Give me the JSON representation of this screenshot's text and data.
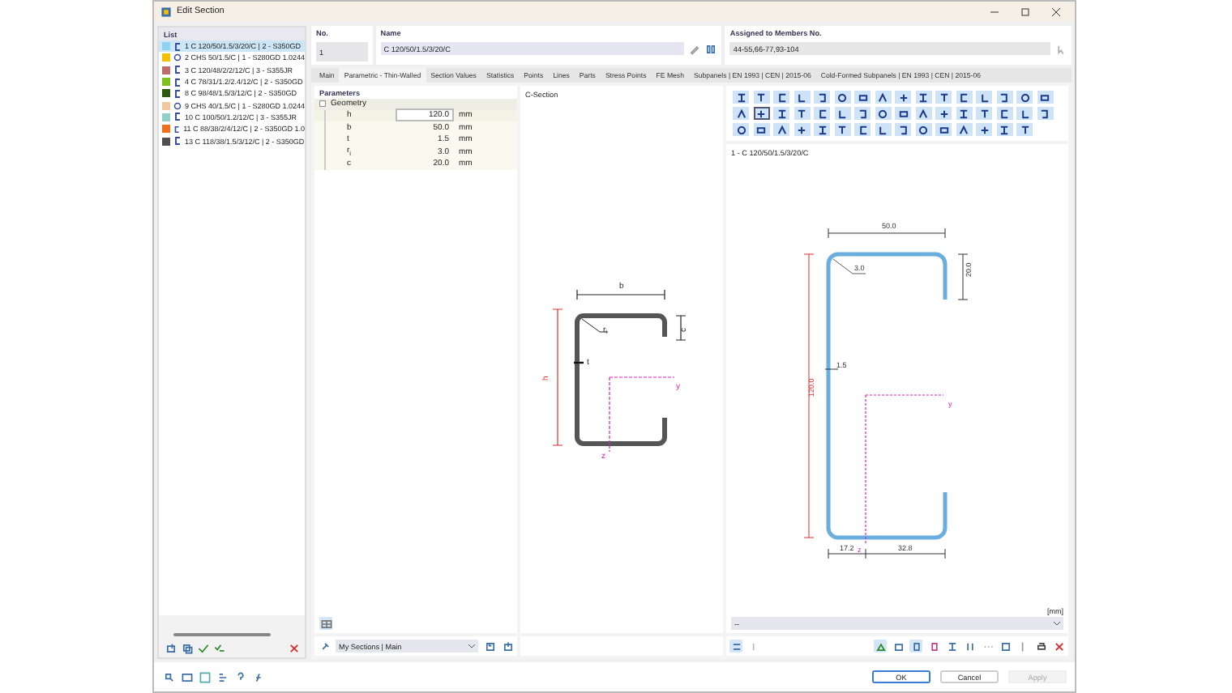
{
  "window": {
    "title": "Edit Section"
  },
  "list": {
    "title": "List",
    "items": [
      {
        "number": "1",
        "label": "C 120/50/1.5/3/20/C | 2 - S350GD",
        "kind": "c-shape",
        "color": "#8fd3f0",
        "selected": true
      },
      {
        "number": "2",
        "label": "CHS 50/1.5/C | 1 - S280GD 1.0244",
        "kind": "tube",
        "color": "#f5c000",
        "selected": false
      },
      {
        "number": "3",
        "label": "C 120/48/2/2/12/C | 3 - S355JR",
        "kind": "c-shape",
        "color": "#c06a6a",
        "selected": false
      },
      {
        "number": "4",
        "label": "C 78/31/1.2/2.4/12/C | 2 - S350GD",
        "kind": "c-shape",
        "color": "#7fc020",
        "selected": false
      },
      {
        "number": "8",
        "label": "C 98/48/1.5/3/12/C | 2 - S350GD",
        "kind": "c-shape",
        "color": "#2c5a10",
        "selected": false
      },
      {
        "number": "9",
        "label": "CHS 40/1.5/C | 1 - S280GD 1.0244",
        "kind": "tube",
        "color": "#f0c8a0",
        "selected": false
      },
      {
        "number": "10",
        "label": "C 100/50/1.2/12/C | 3 - S355JR",
        "kind": "c-shape",
        "color": "#90d0c8",
        "selected": false
      },
      {
        "number": "11",
        "label": "C 88/38/2/4/12/C | 2 - S350GD 1.0",
        "kind": "c-shape",
        "color": "#f07020",
        "selected": false
      },
      {
        "number": "13",
        "label": "C 118/38/1.5/3/12/C | 2 - S350GD",
        "kind": "c-shape",
        "color": "#505050",
        "selected": false
      }
    ]
  },
  "number_field": {
    "label": "No.",
    "value": "1"
  },
  "name_field": {
    "label": "Name",
    "value": "C 120/50/1.5/3/20/C"
  },
  "members_field": {
    "label": "Assigned to Members No.",
    "value": "44-55,66-77,93-104"
  },
  "tabs": [
    {
      "label": "Main",
      "selected": false
    },
    {
      "label": "Parametric - Thin-Walled",
      "selected": true
    },
    {
      "label": "Section Values",
      "selected": false
    },
    {
      "label": "Statistics",
      "selected": false
    },
    {
      "label": "Points",
      "selected": false
    },
    {
      "label": "Lines",
      "selected": false
    },
    {
      "label": "Parts",
      "selected": false
    },
    {
      "label": "Stress Points",
      "selected": false
    },
    {
      "label": "FE Mesh",
      "selected": false
    },
    {
      "label": "Subpanels | EN 1993 | CEN | 2015-06",
      "selected": false
    },
    {
      "label": "Cold-Formed Subpanels | EN 1993 | CEN | 2015-06",
      "selected": false
    }
  ],
  "parameters": {
    "title": "Parameters",
    "group": "Geometry",
    "rows": [
      {
        "symbol": "h",
        "value": "120.0",
        "unit": "mm",
        "selected": true
      },
      {
        "symbol": "b",
        "value": "50.0",
        "unit": "mm",
        "selected": false
      },
      {
        "symbol": "t",
        "value": "1.5",
        "unit": "mm",
        "selected": false
      },
      {
        "symbol": "r$_{i}$",
        "value": "3.0",
        "unit": "mm",
        "selected": false
      },
      {
        "symbol": "c",
        "value": "20.0",
        "unit": "mm",
        "selected": false
      }
    ]
  },
  "library": {
    "value": "My Sections | Main"
  },
  "section_sketch": {
    "title": "C-Section",
    "labels": [
      {
        "kind": "width",
        "text": "b"
      },
      {
        "kind": "lip",
        "text": "c"
      },
      {
        "kind": "height",
        "text": "h"
      },
      {
        "kind": "thickness",
        "text": "t"
      },
      {
        "kind": "radius",
        "text": "r$_{i}$"
      },
      {
        "kind": "y-axis",
        "text": "y"
      },
      {
        "kind": "z-axis",
        "text": "z"
      }
    ]
  },
  "preview": {
    "caption": "1 - C 120/50/1.5/3/20/C",
    "unit_note": "[mm]",
    "dropdown": "--",
    "labels": [
      {
        "kind": "width",
        "text": "50.0"
      },
      {
        "kind": "lip",
        "text": "20.0"
      },
      {
        "kind": "height",
        "text": "120.0"
      },
      {
        "kind": "thickness",
        "text": "1.5"
      },
      {
        "kind": "radius",
        "text": "3.0"
      },
      {
        "kind": "left-offset",
        "text": "17.2"
      },
      {
        "kind": "right-offset",
        "text": "32.8"
      },
      {
        "kind": "y-axis",
        "text": "y"
      },
      {
        "kind": "z-axis",
        "text": "z"
      }
    ]
  },
  "buttons": [
    {
      "label": "OK",
      "disabled": false,
      "focused": true
    },
    {
      "label": "Cancel",
      "disabled": false,
      "focused": false
    },
    {
      "label": "Apply",
      "disabled": true,
      "focused": false
    }
  ]
}
